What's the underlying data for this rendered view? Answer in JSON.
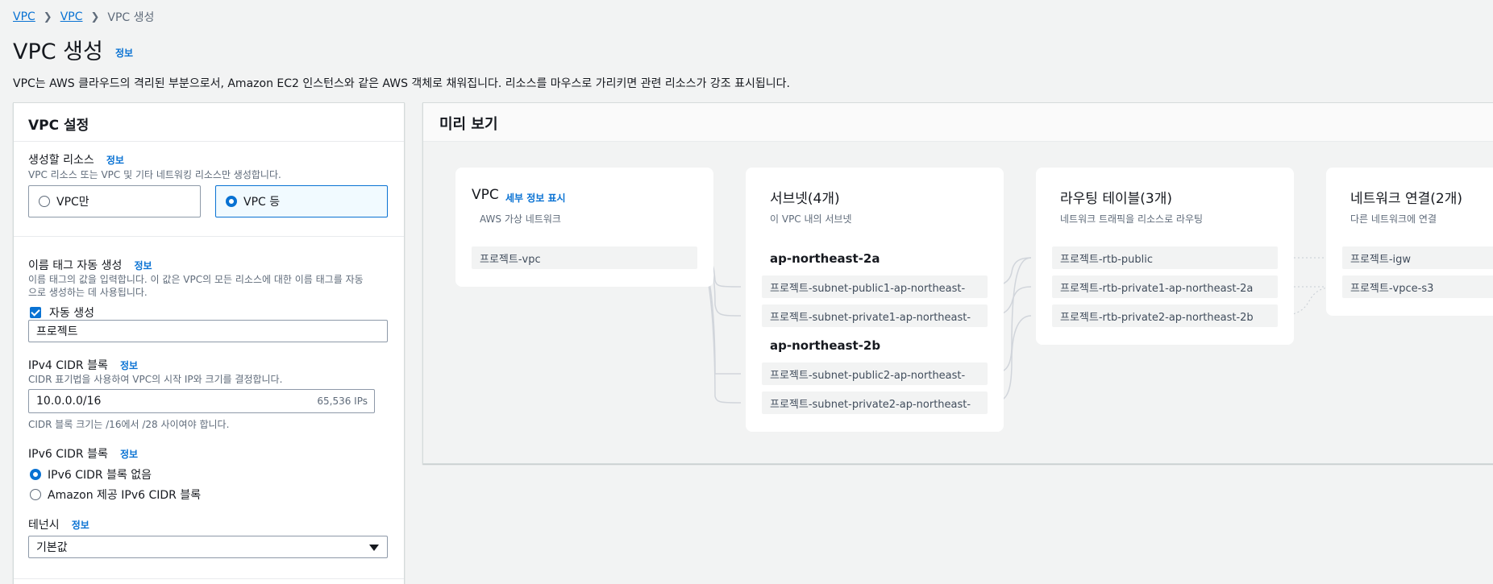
{
  "breadcrumb": [
    "VPC",
    "VPC",
    "VPC 생성"
  ],
  "page": {
    "title": "VPC 생성",
    "info": "정보",
    "description": "VPC는 AWS 클라우드의 격리된 부분으로서, Amazon EC2 인스턴스와 같은 AWS 객체로 채워집니다. 리소스를 마우스로 가리키면 관련 리소스가 강조 표시됩니다."
  },
  "settings": {
    "title": "VPC 설정",
    "resources": {
      "label": "생성할 리소스",
      "info": "정보",
      "desc": "VPC 리소스 또는 VPC 및 기타 네트워킹 리소스만 생성합니다.",
      "options": [
        "VPC만",
        "VPC 등"
      ],
      "selected": "VPC 등"
    },
    "name_tag": {
      "label": "이름 태그 자동 생성",
      "info": "정보",
      "desc_line1": "이름 태그의 값을 입력합니다. 이 값은 VPC의 모든 리소스에 대한 이름 태그를 자동",
      "desc_line2": "으로 생성하는 데 사용됩니다.",
      "auto_label": "자동 생성",
      "auto_checked": true,
      "value": "프로젝트"
    },
    "ipv4": {
      "label": "IPv4 CIDR 블록",
      "info": "정보",
      "desc": "CIDR 표기법을 사용하여 VPC의 시작 IP와 크기를 결정합니다.",
      "value": "10.0.0.0/16",
      "ips": "65,536 IPs",
      "hint": "CIDR 블록 크기는 /16에서 /28 사이여야 합니다."
    },
    "ipv6": {
      "label": "IPv6 CIDR 블록",
      "info": "정보",
      "options": [
        "IPv6 CIDR 블록 없음",
        "Amazon 제공 IPv6 CIDR 블록"
      ],
      "selected": "IPv6 CIDR 블록 없음"
    },
    "tenancy": {
      "label": "테넌시",
      "info": "정보",
      "value": "기본값"
    }
  },
  "preview": {
    "title": "미리 보기",
    "vpc": {
      "title": "VPC",
      "details_link": "세부 정보 표시",
      "sub": "AWS 가상 네트워크",
      "node": "프로젝트-vpc"
    },
    "subnets": {
      "title": "서브넷(4개)",
      "sub": "이 VPC 내의 서브넷",
      "az1": "ap-northeast-2a",
      "az1_nodes": [
        "프로젝트-subnet-public1-ap-northeast-",
        "프로젝트-subnet-private1-ap-northeast-"
      ],
      "az2": "ap-northeast-2b",
      "az2_nodes": [
        "프로젝트-subnet-public2-ap-northeast-",
        "프로젝트-subnet-private2-ap-northeast-"
      ]
    },
    "route_tables": {
      "title": "라우팅 테이블(3개)",
      "sub": "네트워크 트래픽을 리소스로 라우팅",
      "nodes": [
        "프로젝트-rtb-public",
        "프로젝트-rtb-private1-ap-northeast-2a",
        "프로젝트-rtb-private2-ap-northeast-2b"
      ]
    },
    "connections": {
      "title": "네트워크 연결(2개)",
      "sub": "다른 네트워크에 연결",
      "nodes": [
        "프로젝트-igw",
        "프로젝트-vpce-s3"
      ]
    }
  }
}
